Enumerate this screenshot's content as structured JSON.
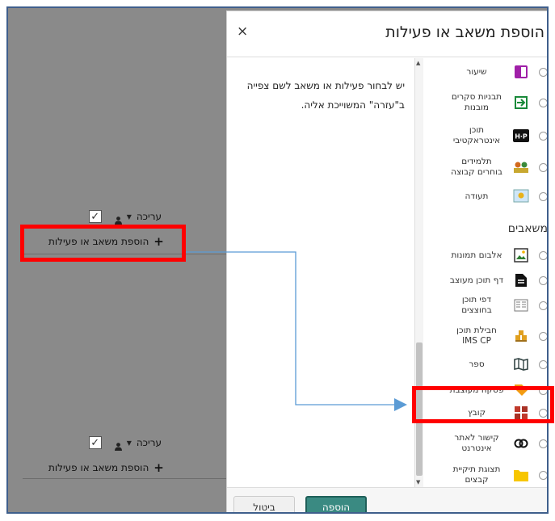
{
  "background": {
    "rows": [
      {
        "edit_label": "עריכה",
        "add_label": "הוספת משאב או פעילות"
      },
      {
        "edit_label": "עריכה",
        "add_label": "הוספת משאב או פעילות"
      }
    ]
  },
  "dialog": {
    "title": "הוספת משאב או פעילות",
    "close": "×",
    "help_text": "יש לבחור פעילות או משאב לשם צפייה ב\"עזרה\" המשוייכת אליה.",
    "activities": [
      {
        "name": "שיעור",
        "icon": "lesson-icon"
      },
      {
        "name": "תבניות סקרים מובנות",
        "icon": "survey-icon"
      },
      {
        "name": "תוכן אינטראקטיבי",
        "icon": "h5p-icon"
      },
      {
        "name": "תלמידים בוחרים קבוצה",
        "icon": "group-choice-icon"
      },
      {
        "name": "תעודה",
        "icon": "certificate-icon"
      }
    ],
    "resources_heading": "משאבים",
    "resources": [
      {
        "name": "אלבום תמונות",
        "icon": "image-gallery-icon"
      },
      {
        "name": "דף תוכן מעוצב",
        "icon": "page-icon"
      },
      {
        "name": "דפי תוכן בחוצצים",
        "icon": "tabbed-pages-icon"
      },
      {
        "name": "חבילת תוכן IMS CP",
        "icon": "ims-package-icon"
      },
      {
        "name": "ספר",
        "icon": "book-icon"
      },
      {
        "name": "פסקה מעוצבת",
        "icon": "label-icon"
      },
      {
        "name": "קובץ",
        "icon": "file-icon"
      },
      {
        "name": "קישור לאתר אינטרנט",
        "icon": "url-link-icon"
      },
      {
        "name": "תצוגת תיקיית קבצים",
        "icon": "folder-icon"
      }
    ],
    "add_button": "הוספה",
    "cancel_button": "ביטול"
  },
  "colors": {
    "annotation": "#ff0000",
    "arrow": "#5b9bd5",
    "primary_button": "#3a8a82"
  }
}
